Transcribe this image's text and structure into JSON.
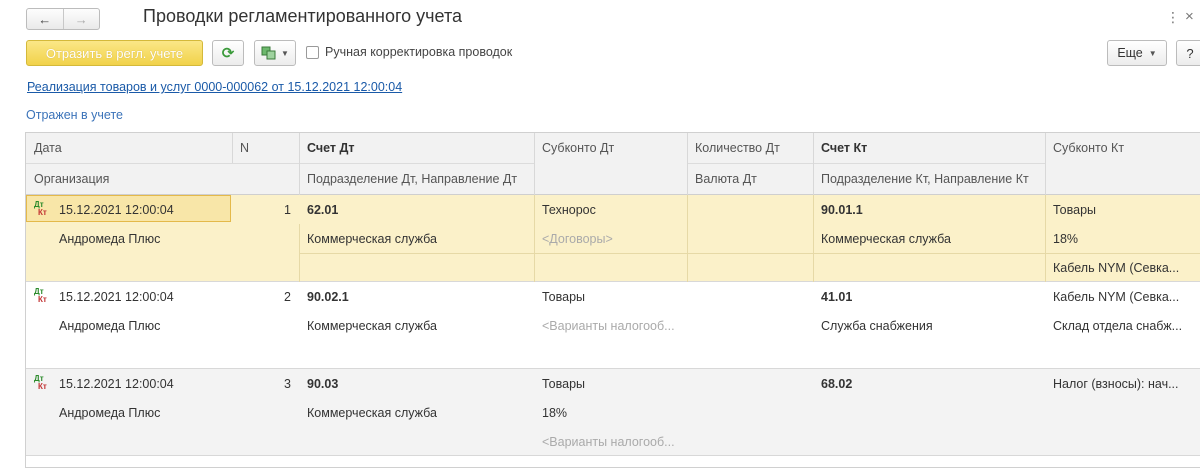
{
  "window": {
    "title": "Проводки регламентированного учета",
    "nav_back": "←",
    "nav_forward": "→"
  },
  "toolbar": {
    "post_button": "Отразить в регл. учете",
    "refresh_icon": "refresh-icon",
    "manual_checkbox_checked": false,
    "manual_checkbox_label": "Ручная корректировка проводок",
    "more_button": "Еще",
    "help_button": "?"
  },
  "document_link": "Реализация товаров и услуг 0000-000062 от 15.12.2021 12:00:04",
  "status_text": "Отражен в учете",
  "grid": {
    "headers": {
      "date": "Дата",
      "n": "N",
      "account_dt": "Счет Дт",
      "subconto_dt": "Субконто Дт",
      "qty_dt": "Количество Дт",
      "account_kt": "Счет Кт",
      "subconto_kt": "Субконто Кт",
      "organization": "Организация",
      "dept_dt": "Подразделение Дт, Направление Дт",
      "currency_dt": "Валюта Дт",
      "dept_kt": "Подразделение Кт, Направление Кт"
    },
    "rows": [
      {
        "date": "15.12.2021 12:00:04",
        "n": "1",
        "organization": "Андромеда Плюс",
        "account_dt": "62.01",
        "dept_dt": "Коммерческая служба",
        "subconto_dt": [
          "Технорос",
          "<Договоры>",
          ""
        ],
        "account_kt": "90.01.1",
        "dept_kt": "Коммерческая служба",
        "subconto_kt": [
          "Товары",
          "18%",
          "Кабель NYM (Севка..."
        ]
      },
      {
        "date": "15.12.2021 12:00:04",
        "n": "2",
        "organization": "Андромеда Плюс",
        "account_dt": "90.02.1",
        "dept_dt": "Коммерческая служба",
        "subconto_dt": [
          "Товары",
          "<Варианты налогооб...",
          ""
        ],
        "account_kt": "41.01",
        "dept_kt": "Служба снабжения",
        "subconto_kt": [
          "Кабель NYM (Севка...",
          "Склад отдела снабж...",
          ""
        ]
      },
      {
        "date": "15.12.2021 12:00:04",
        "n": "3",
        "organization": "Андромеда Плюс",
        "account_dt": "90.03",
        "dept_dt": "Коммерческая служба",
        "subconto_dt": [
          "Товары",
          "18%",
          "<Варианты налогооб..."
        ],
        "account_kt": "68.02",
        "dept_kt": "",
        "subconto_kt": [
          "Налог (взносы): нач...",
          "",
          ""
        ]
      }
    ],
    "row_icon_dt": "Дт",
    "row_icon_kt": "Кт"
  },
  "colors": {
    "primary_button": "#f1d24a",
    "selected_row": "#fbf1c9",
    "link": "#1a5aa8",
    "status": "#3b73b9"
  }
}
